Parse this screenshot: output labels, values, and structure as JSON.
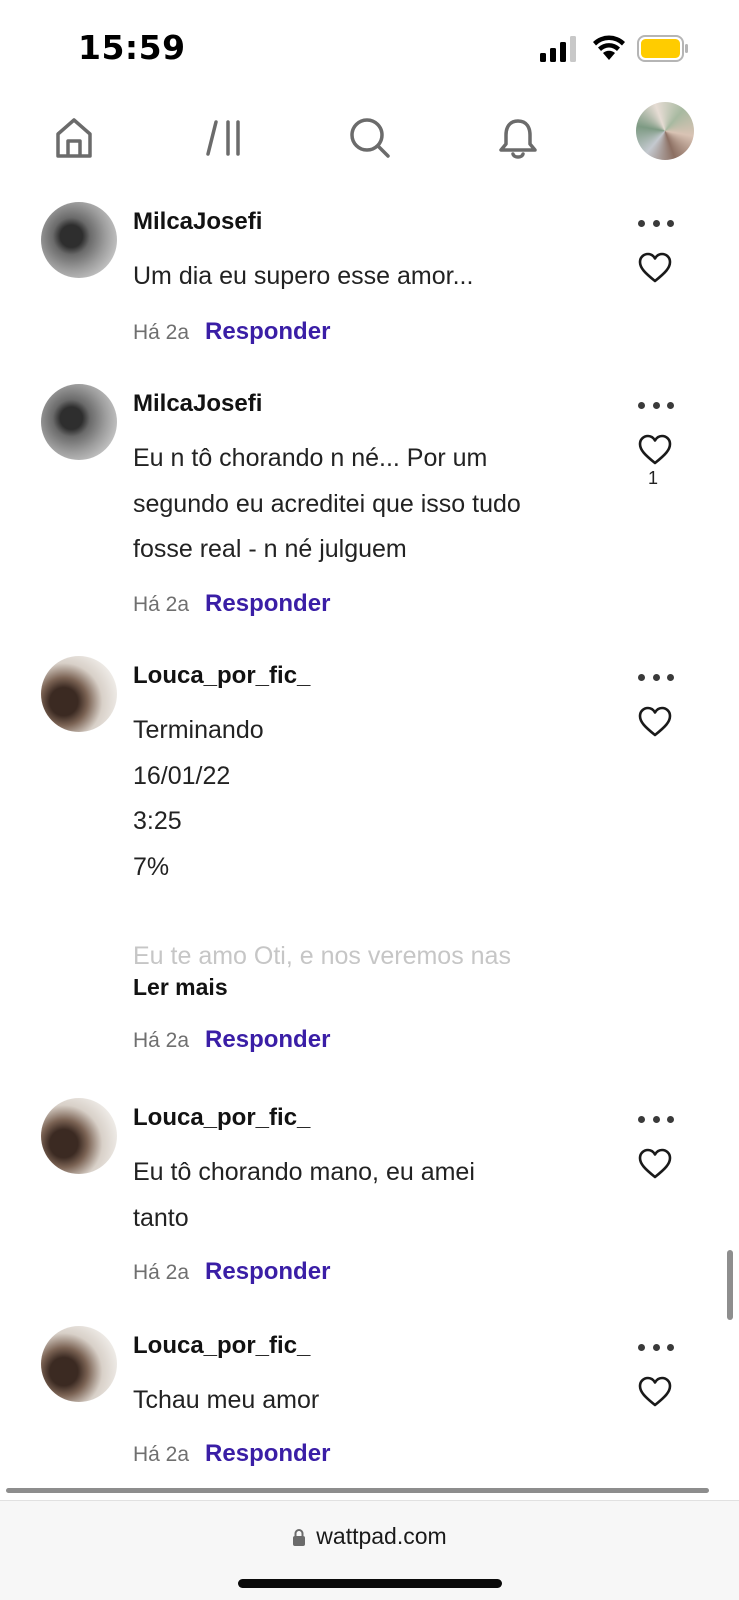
{
  "status_bar": {
    "time": "15:59",
    "battery_color": "#FFCC00"
  },
  "nav": {
    "icons": [
      "home-icon",
      "library-icon",
      "search-icon",
      "bell-icon",
      "profile-avatar"
    ]
  },
  "colors": {
    "reply": "#3A1EA6",
    "meta": "#6F6F6F"
  },
  "comments": [
    {
      "username": "MilcaJosefi",
      "lines": [
        "Um dia eu supero esse amor..."
      ],
      "time": "Há 2a",
      "reply_label": "Responder"
    },
    {
      "username": "MilcaJosefi",
      "lines": [
        "Eu n tô chorando n né... Por um",
        "segundo eu acreditei que isso tudo",
        "fosse real - n né julguem"
      ],
      "time": "Há 2a",
      "reply_label": "Responder",
      "like_count": "1"
    },
    {
      "username": "Louca_por_fic_",
      "lines": [
        "Terminando",
        "16/01/22",
        "3:25",
        "7%"
      ],
      "fade_line": "Eu te amo Oti, e nos veremos nas",
      "read_more": "Ler mais",
      "time": "Há 2a",
      "reply_label": "Responder"
    },
    {
      "username": "Louca_por_fic_",
      "lines": [
        "Eu tô chorando mano, eu amei",
        "tanto"
      ],
      "time": "Há 2a",
      "reply_label": "Responder"
    },
    {
      "username": "Louca_por_fic_",
      "lines": [
        "Tchau meu amor"
      ],
      "time": "Há 2a",
      "reply_label": "Responder"
    }
  ],
  "browser": {
    "url": "wattpad.com"
  }
}
